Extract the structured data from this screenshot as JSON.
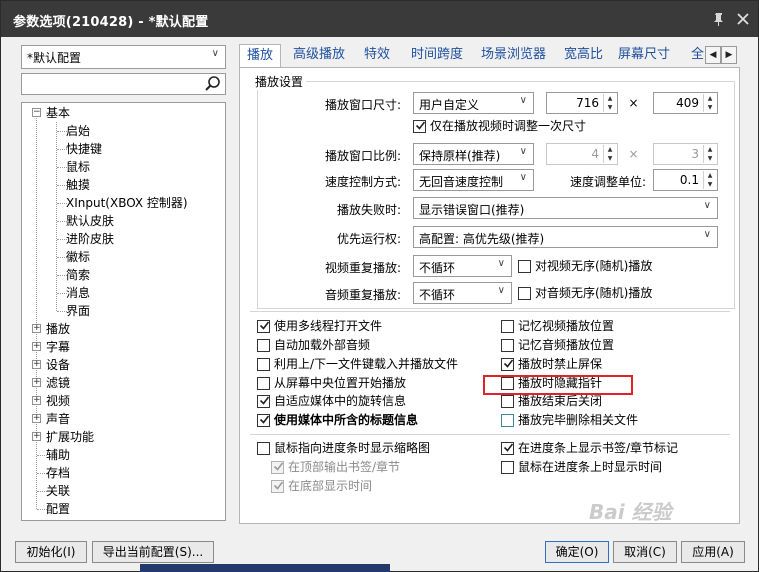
{
  "window": {
    "title": "参数选项(210428) - *默认配置",
    "pin_icon": "pin-icon",
    "close_icon": "close-icon"
  },
  "sidebar": {
    "profile_select": "*默认配置",
    "search_placeholder": "",
    "tree": [
      {
        "label": "基本",
        "level": 0,
        "expanded": true
      },
      {
        "label": "启始",
        "level": 1
      },
      {
        "label": "快捷键",
        "level": 1
      },
      {
        "label": "鼠标",
        "level": 1
      },
      {
        "label": "触摸",
        "level": 1
      },
      {
        "label": "XInput(XBOX 控制器)",
        "level": 1
      },
      {
        "label": "默认皮肤",
        "level": 1
      },
      {
        "label": "进阶皮肤",
        "level": 1
      },
      {
        "label": "徽标",
        "level": 1
      },
      {
        "label": "简索",
        "level": 1
      },
      {
        "label": "消息",
        "level": 1
      },
      {
        "label": "界面",
        "level": 1
      },
      {
        "label": "播放",
        "level": 0,
        "expanded": false,
        "selected": true
      },
      {
        "label": "字幕",
        "level": 0,
        "expanded": false
      },
      {
        "label": "设备",
        "level": 0,
        "expanded": false
      },
      {
        "label": "滤镜",
        "level": 0,
        "expanded": false
      },
      {
        "label": "视频",
        "level": 0,
        "expanded": false
      },
      {
        "label": "声音",
        "level": 0,
        "expanded": false
      },
      {
        "label": "扩展功能",
        "level": 0,
        "expanded": false
      },
      {
        "label": "辅助",
        "level": 0
      },
      {
        "label": "存档",
        "level": 0
      },
      {
        "label": "关联",
        "level": 0
      },
      {
        "label": "配置",
        "level": 0
      }
    ]
  },
  "tabs": [
    "播放",
    "高级播放",
    "特效",
    "时间跨度",
    "场景浏览器",
    "宽高比",
    "屏幕尺寸",
    "全"
  ],
  "active_tab": "播放",
  "playback": {
    "group_title": "播放设置",
    "window_size_label": "播放窗口尺寸:",
    "window_size_value": "用户自定义",
    "width_value": "716",
    "height_value": "409",
    "times": "×",
    "adjust_once_label": "仅在播放视频时调整一次尺寸",
    "ratio_label": "播放窗口比例:",
    "ratio_value": "保持原样(推荐)",
    "ratio_w": "4",
    "ratio_h": "3",
    "speed_mode_label": "速度控制方式:",
    "speed_mode_value": "无回音速度控制",
    "speed_unit_label": "速度调整单位:",
    "speed_unit_value": "0.1",
    "fail_label": "播放失败时:",
    "fail_value": "显示错误窗口(推荐)",
    "priority_label": "优先运行权:",
    "priority_value": "高配置: 高优先级(推荐)",
    "video_repeat_label": "视频重复播放:",
    "video_repeat_value": "不循环",
    "video_shuffle_label": "对视频无序(随机)播放",
    "audio_repeat_label": "音频重复播放:",
    "audio_repeat_value": "不循环",
    "audio_shuffle_label": "对音频无序(随机)播放"
  },
  "options_left": [
    {
      "label": "使用多线程打开文件",
      "checked": true
    },
    {
      "label": "自动加载外部音频",
      "checked": false
    },
    {
      "label": "利用上/下一文件键载入并播放文件",
      "checked": false
    },
    {
      "label": "从屏幕中央位置开始播放",
      "checked": false
    },
    {
      "label": "自适应媒体中的旋转信息",
      "checked": true
    },
    {
      "label": "使用媒体中所含的标题信息",
      "checked": true,
      "bold": true
    }
  ],
  "options_right": [
    {
      "label": "记忆视频播放位置",
      "checked": false
    },
    {
      "label": "记忆音频播放位置",
      "checked": false
    },
    {
      "label": "播放时禁止屏保",
      "checked": true
    },
    {
      "label": "播放时隐藏指针",
      "checked": false,
      "highlighted": true
    },
    {
      "label": "播放结束后关闭",
      "checked": false
    },
    {
      "label": "播放完毕删除相关文件",
      "checked": false
    }
  ],
  "seekbar": {
    "thumb_label": "鼠标指向进度条时显示缩略图",
    "top_bookmarks_label": "在顶部输出书签/章节",
    "bottom_time_label": "在底部显示时间",
    "show_marks_label": "在进度条上显示书签/章节标记",
    "hover_time_label": "鼠标在进度条上时显示时间"
  },
  "footer": {
    "init_button": "初始化(I)",
    "export_button": "导出当前配置(S)...",
    "ok_button": "确定(O)",
    "cancel_button": "取消(C)",
    "apply_button": "应用(A)"
  },
  "watermark": "Bai 经验",
  "colors": {
    "titlebar": "#3a3a3a",
    "tab_text": "#1f4f9e",
    "highlight_box": "#e0232b"
  }
}
